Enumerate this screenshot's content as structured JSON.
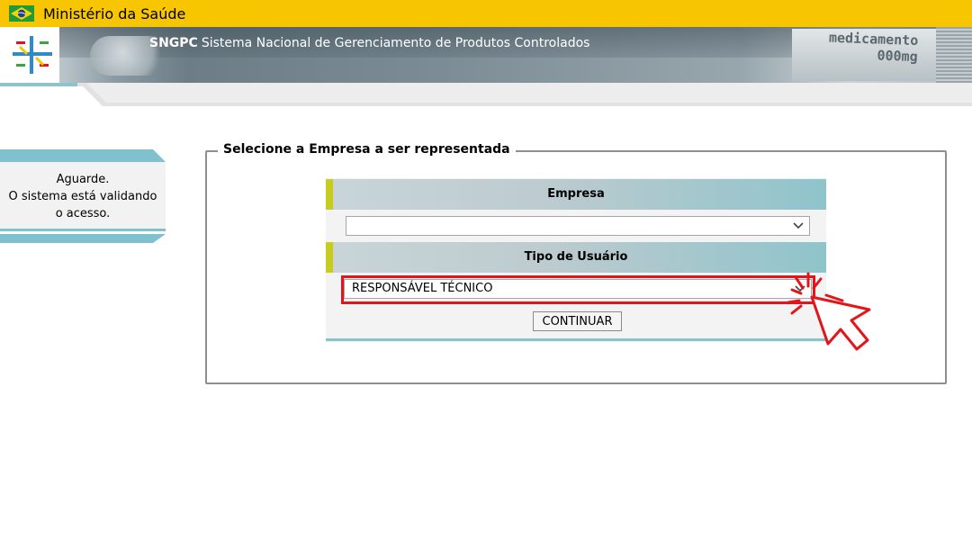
{
  "top_bar": {
    "ministry": "Ministério da Saúde"
  },
  "banner": {
    "app_acronym": "SNGPC",
    "app_name": "Sistema Nacional de Gerenciamento de Produtos Controlados",
    "box_line1": "medicamento",
    "box_line2": "000mg"
  },
  "sidebar": {
    "line1": "Aguarde.",
    "line2": "O sistema está validando",
    "line3": "o acesso."
  },
  "form": {
    "legend": "Selecione a Empresa a ser representada",
    "empresa_label": "Empresa",
    "empresa_value": "",
    "tipo_label": "Tipo de Usuário",
    "tipo_value": "RESPONSÁVEL TÉCNICO",
    "continue_label": "CONTINUAR"
  },
  "colors": {
    "top_bar": "#f7c600",
    "accent_teal": "#7fc1cc",
    "highlight_red": "#e3151a",
    "header_mark": "#c8cc1f"
  },
  "icons": [
    "brazil-flag-icon",
    "anvisa-logo",
    "chevron-down-icon",
    "pointer-cursor-icon"
  ]
}
